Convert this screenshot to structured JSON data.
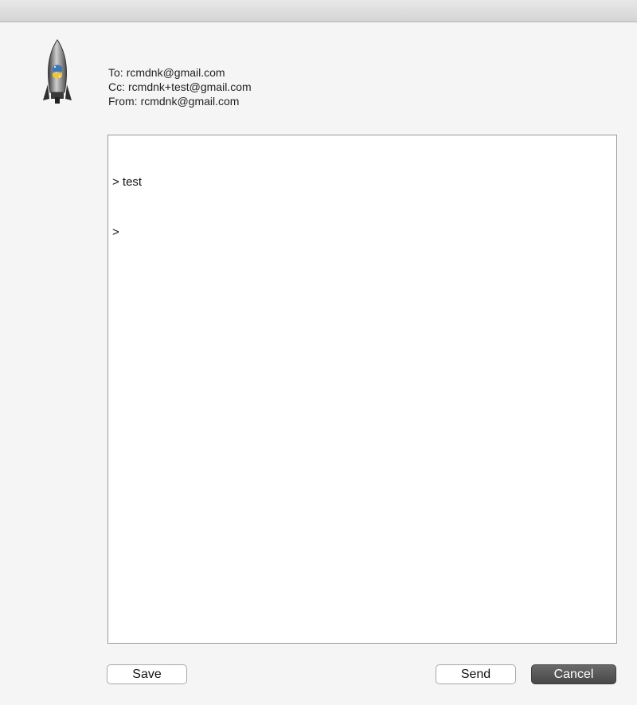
{
  "window": {
    "app_icon": "rocket-python-icon"
  },
  "headers": {
    "to_label": "To:",
    "to_value": "rcmdnk@gmail.com",
    "cc_label": "Cc:",
    "cc_value": "rcmdnk+test@gmail.com",
    "from_label": "From:",
    "from_value": "rcmdnk@gmail.com"
  },
  "body": {
    "lines": [
      "> test",
      ">"
    ]
  },
  "buttons": {
    "save_label": "Save",
    "send_label": "Send",
    "cancel_label": "Cancel"
  },
  "colors": {
    "window_bg": "#f5f5f5",
    "cancel_bg": "#555555"
  }
}
